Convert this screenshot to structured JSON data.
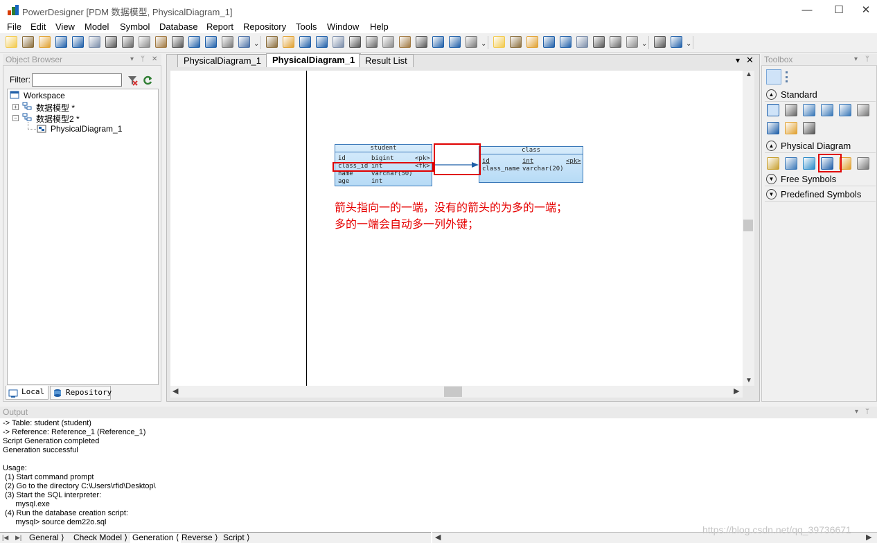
{
  "window": {
    "title": "PowerDesigner [PDM 数据模型, PhysicalDiagram_1]",
    "minimize_glyph": "—",
    "maximize_glyph": "☐",
    "close_glyph": "✕"
  },
  "menu": [
    "File",
    "Edit",
    "View",
    "Model",
    "Symbol",
    "Database",
    "Report",
    "Repository",
    "Tools",
    "Window",
    "Help"
  ],
  "toolbar": {
    "icons": [
      "new-icon",
      "new-model-icon",
      "open-icon",
      "save-icon",
      "save-all-icon",
      "print-preview-icon",
      "print-icon",
      "cut-icon",
      "copy-icon",
      "paste-icon",
      "delete-icon",
      "undo-icon",
      "redo-icon",
      "properties-icon",
      "model-check-icon",
      "more-icon",
      "workspace-icon",
      "package-icon",
      "browser-icon",
      "refresh-icon",
      "check-icon",
      "window-icon",
      "list-icon",
      "pencil-icon",
      "plot-icon",
      "font-icon",
      "image-icon",
      "back-icon",
      "forward-icon",
      "more-icon",
      "align-icon",
      "group-icon",
      "layout-icon",
      "zoom-page-icon",
      "generate-icon",
      "diagram-icon",
      "select-mode-icon",
      "comment-icon",
      "grid-icon",
      "more-icon",
      "preview-icon",
      "printer-icon",
      "more-icon"
    ],
    "more_glyph": "⌄"
  },
  "object_browser": {
    "title": "Object Browser",
    "filter_label": "Filter:",
    "filter_value": "",
    "tree": {
      "workspace": "Workspace",
      "model1": "数据模型 *",
      "model2": "数据模型2 *",
      "diagram": "PhysicalDiagram_1"
    },
    "tabs": [
      "Local",
      "Repository"
    ]
  },
  "document": {
    "tabs": [
      "PhysicalDiagram_1",
      "PhysicalDiagram_1",
      "Result List"
    ],
    "active_tab_index": 1,
    "menu_glyph": "▾",
    "close_glyph": "✕"
  },
  "diagram": {
    "student": {
      "name": "student",
      "columns": [
        {
          "name": "id",
          "type": "bigint",
          "key": "<pk>"
        },
        {
          "name": "class_id",
          "type": "int",
          "key": "<fk>"
        },
        {
          "name": "name",
          "type": "varchar(50)",
          "key": ""
        },
        {
          "name": "age",
          "type": "int",
          "key": ""
        }
      ]
    },
    "class": {
      "name": "class",
      "columns": [
        {
          "name": "id",
          "type": "int",
          "key": "<pk>"
        },
        {
          "name": "class_name",
          "type": "varchar(20)",
          "key": ""
        }
      ]
    },
    "note_line1": "箭头指向一的一端，没有的箭头的为多的一端；",
    "note_line2": "多的一端会自动多一列外键；",
    "annotation_color": "#e00000"
  },
  "toolbox": {
    "title": "Toolbox",
    "sections": {
      "standard": "Standard",
      "physical": "Physical Diagram",
      "free": "Free Symbols",
      "predefined": "Predefined Symbols"
    },
    "standard_tools": [
      "pointer-icon",
      "grabber-icon",
      "zoom-in-icon",
      "zoom-out-icon",
      "zoom-fit-icon",
      "properties-icon",
      "cut-icon",
      "note-icon",
      "link-icon"
    ],
    "physical_tools": [
      "package-icon",
      "table-icon",
      "view-icon",
      "reference-icon",
      "procedure-icon",
      "file-icon"
    ],
    "highlighted_tool": "reference-icon"
  },
  "output": {
    "title": "Output",
    "lines": [
      "-> Table: student (student)",
      "-> Reference: Reference_1 (Reference_1)",
      "Script Generation completed",
      "Generation successful",
      "",
      "Usage:",
      " (1) Start command prompt",
      " (2) Go to the directory C:\\Users\\rfid\\Desktop\\",
      " (3) Start the SQL interpreter:",
      "      mysql.exe",
      " (4) Run the database creation script:",
      "      mysql> source dem22o.sql"
    ],
    "tabs": [
      "General",
      "Check Model",
      "Generation",
      "Reverse",
      "Script"
    ],
    "active_tab": "Generation"
  },
  "watermark": "https://blog.csdn.net/qq_39736671",
  "colors": {
    "accent": "#3a78b8",
    "annotation": "#e60000",
    "table_fill": "#c8e3f8"
  }
}
